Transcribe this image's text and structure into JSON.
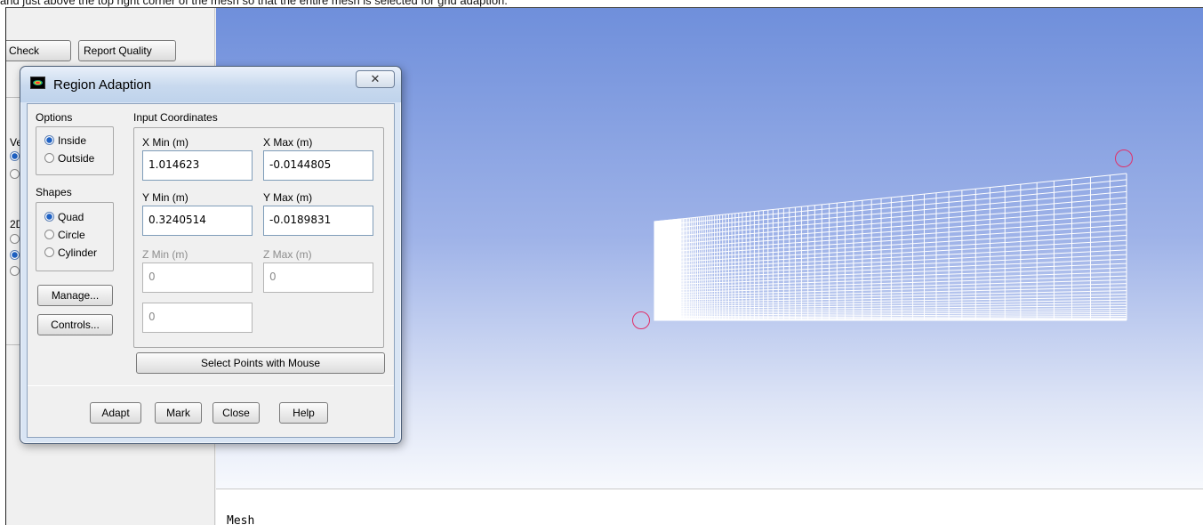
{
  "caption": "and just above the top right corner of the mesh so that the entire mesh is selected for grid adaption.",
  "left_panel": {
    "check_label": "Check",
    "report_quality_label": "Report Quality",
    "frag_ve": "Ve",
    "frag_2d": "2D"
  },
  "console": {
    "text": "Mesh"
  },
  "dialog": {
    "title": "Region Adaption",
    "close_glyph": "✕",
    "options": {
      "label": "Options",
      "items": [
        {
          "label": "Inside",
          "selected": true
        },
        {
          "label": "Outside",
          "selected": false
        }
      ]
    },
    "shapes": {
      "label": "Shapes",
      "items": [
        {
          "label": "Quad",
          "selected": true
        },
        {
          "label": "Circle",
          "selected": false
        },
        {
          "label": "Cylinder",
          "selected": false
        }
      ]
    },
    "manage_label": "Manage...",
    "controls_label": "Controls...",
    "input_coordinates": {
      "label": "Input Coordinates",
      "x_min": {
        "label": "X Min (m)",
        "value": "1.014623"
      },
      "x_max": {
        "label": "X Max (m)",
        "value": "-0.0144805"
      },
      "y_min": {
        "label": "Y Min (m)",
        "value": "0.3240514"
      },
      "y_max": {
        "label": "Y Max (m)",
        "value": "-0.0189831"
      },
      "z_min": {
        "label": "Z Min (m)",
        "value": "0"
      },
      "z_max": {
        "label": "Z Max (m)",
        "value": "0"
      },
      "radius": {
        "value": "0"
      }
    },
    "select_points_label": "Select Points with Mouse",
    "buttons": {
      "adapt": "Adapt",
      "mark": "Mark",
      "close": "Close",
      "help": "Help"
    }
  },
  "colors": {
    "viewport_top": "#6f8fdb",
    "viewport_bottom": "#f7f9fd",
    "marker": "#e0306a",
    "mesh": "#ffffff"
  }
}
